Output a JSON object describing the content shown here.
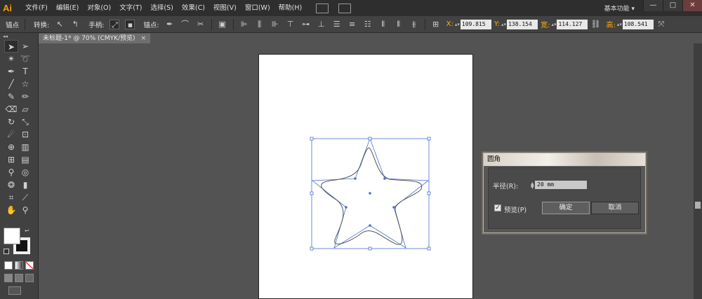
{
  "app": {
    "logo": "Ai",
    "workspace": "基本功能 ▾"
  },
  "menu": [
    "文件(F)",
    "编辑(E)",
    "对象(O)",
    "文字(T)",
    "选择(S)",
    "效果(C)",
    "视图(V)",
    "窗口(W)",
    "帮助(H)"
  ],
  "window_controls": {
    "minimize": "—",
    "maximize": "□",
    "close": "✕"
  },
  "control": {
    "selection_type": "锚点",
    "convert_label": "转换:",
    "handles_label": "手柄:",
    "anchor_label": "锚点:",
    "x_label": "X:",
    "x_value": "109.815",
    "y_label": "Y:",
    "y_value": "138.154",
    "w_label": "宽:",
    "w_value": "114.127",
    "h_label": "高:",
    "h_value": "108.541"
  },
  "document": {
    "tab_title": "未标题-1* @ 70% (CMYK/预览)",
    "tab_close": "×"
  },
  "toolbar": {
    "collapse": "◂◂",
    "icons": [
      [
        "selection-icon",
        "direct-selection-icon"
      ],
      [
        "magic-wand-icon",
        "lasso-icon"
      ],
      [
        "pen-icon",
        "type-icon"
      ],
      [
        "line-segment-icon",
        "star-shape-icon"
      ],
      [
        "paintbrush-icon",
        "pencil-icon"
      ],
      [
        "blob-brush-icon",
        "eraser-icon"
      ],
      [
        "rotate-icon",
        "scale-icon"
      ],
      [
        "warp-icon",
        "free-transform-icon"
      ],
      [
        "shape-builder-icon",
        "perspective-grid-icon"
      ],
      [
        "mesh-icon",
        "gradient-icon"
      ],
      [
        "eyedropper-icon",
        "blend-icon"
      ],
      [
        "symbol-sprayer-icon",
        "column-graph-icon"
      ],
      [
        "artboard-icon",
        "slice-icon"
      ],
      [
        "hand-icon",
        "zoom-icon"
      ]
    ]
  },
  "dialog": {
    "title": "圆角",
    "radius_label": "半径(R):",
    "radius_value": "20 mm",
    "preview_label": "预览(P)",
    "preview_checked": "✓",
    "ok_label": "确定",
    "cancel_label": "取消"
  },
  "colors": {
    "accent": "#ff9a00",
    "selection": "#4b6fd0",
    "canvas": "#535353"
  }
}
